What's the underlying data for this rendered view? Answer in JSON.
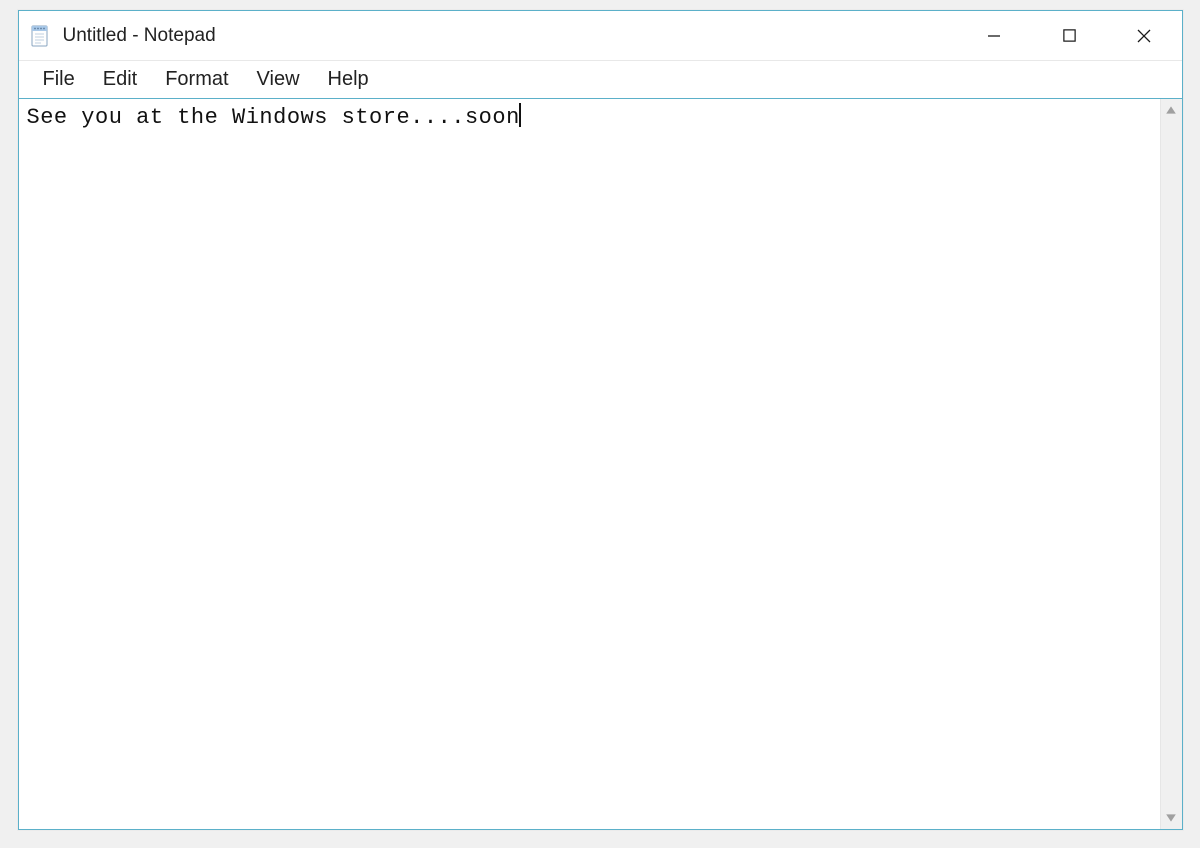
{
  "titlebar": {
    "title": "Untitled - Notepad"
  },
  "menu": {
    "items": [
      "File",
      "Edit",
      "Format",
      "View",
      "Help"
    ]
  },
  "editor": {
    "content": "See you at the Windows store....soon"
  }
}
